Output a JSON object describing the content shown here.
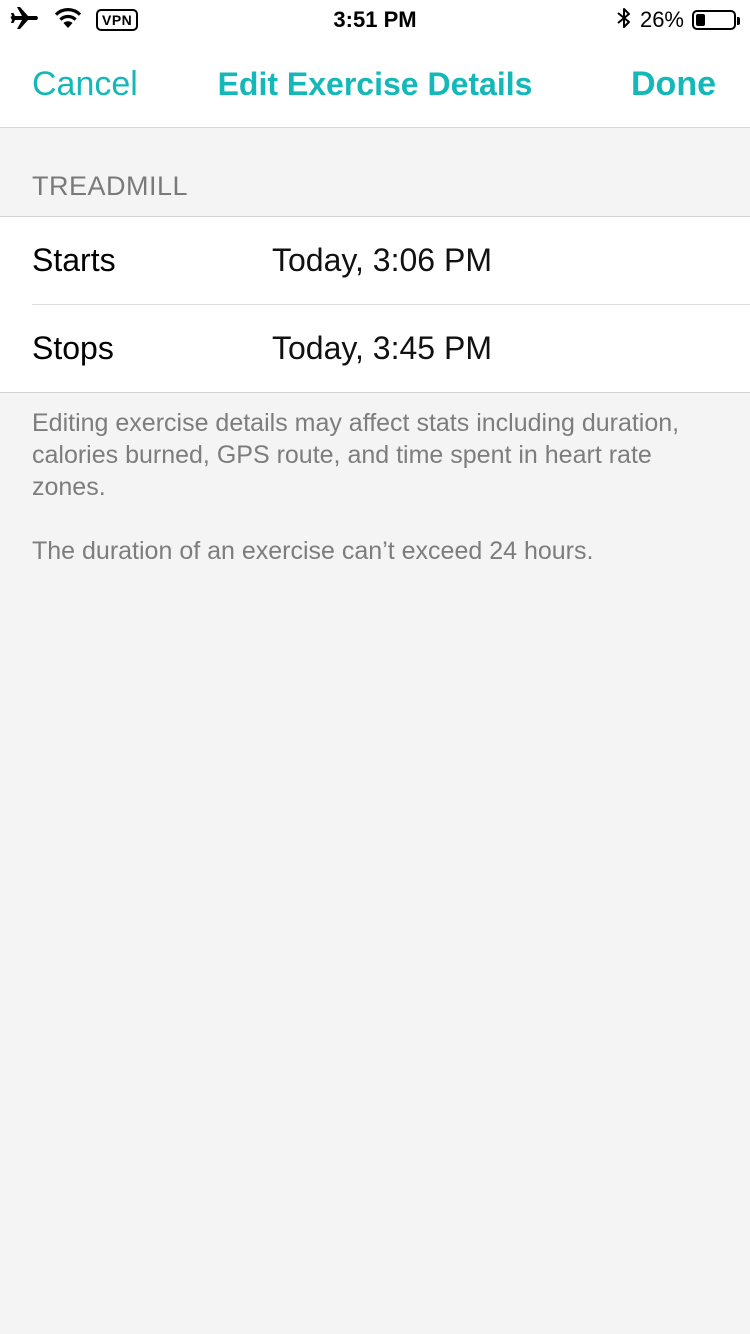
{
  "status_bar": {
    "vpn_label": "VPN",
    "time": "3:51 PM",
    "battery_percent": "26%",
    "battery_level": 0.26,
    "icons": [
      "airplane-icon",
      "wifi-icon",
      "bluetooth-icon",
      "battery-icon"
    ]
  },
  "nav": {
    "cancel_label": "Cancel",
    "title": "Edit Exercise Details",
    "done_label": "Done"
  },
  "section": {
    "header": "TREADMILL",
    "rows": [
      {
        "label": "Starts",
        "value": "Today, 3:06 PM"
      },
      {
        "label": "Stops",
        "value": "Today, 3:45 PM"
      }
    ]
  },
  "notes": [
    "Editing exercise details may affect stats including duration, calories burned, GPS route, and time spent in heart rate zones.",
    "The duration of an exercise can’t exceed 24 hours."
  ],
  "colors": {
    "accent": "#14b8b8",
    "background": "#f4f4f4",
    "secondary_text": "#7d7d7d"
  }
}
